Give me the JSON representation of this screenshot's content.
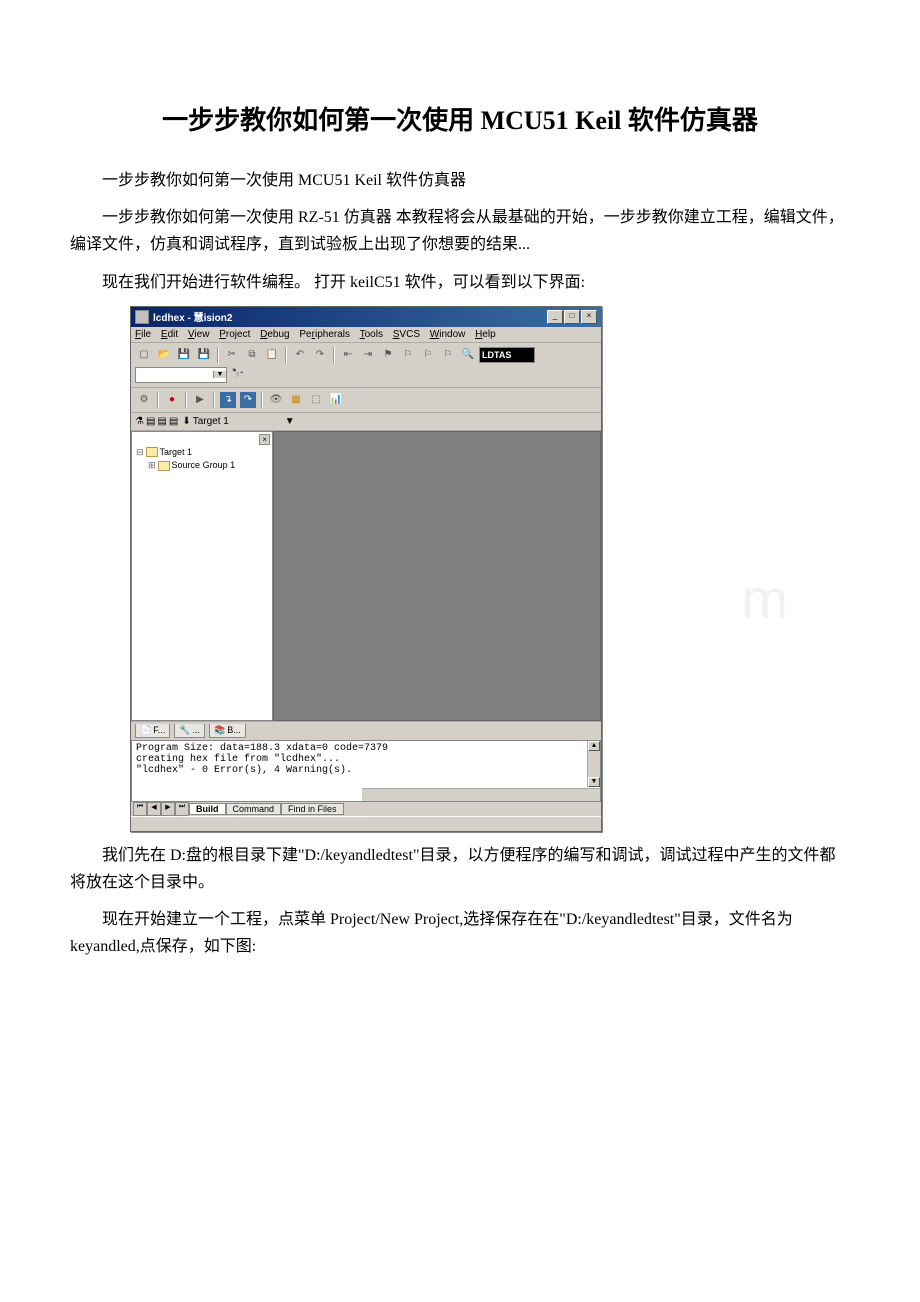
{
  "doc": {
    "title": "一步步教你如何第一次使用 MCU51 Keil 软件仿真器",
    "p1": "一步步教你如何第一次使用 MCU51 Keil 软件仿真器",
    "p2": "一步步教你如何第一次使用 RZ-51 仿真器 本教程将会从最基础的开始，一步步教你建立工程，编辑文件，编译文件，仿真和调试程序，直到试验板上出现了你想要的结果...",
    "p3": "现在我们开始进行软件编程。 打开 keilC51 软件，可以看到以下界面:",
    "p4": "我们先在 D:盘的根目录下建\"D:/keyandledtest\"目录，以方便程序的编写和调试，调试过程中产生的文件都将放在这个目录中。",
    "p5": "现在开始建立一个工程，点菜单 Project/New Project,选择保存在在\"D:/keyandledtest\"目录，文件名为 keyandled,点保存，如下图:"
  },
  "keil": {
    "title": "lcdhex - 慧ision2",
    "menus": [
      "File",
      "Edit",
      "View",
      "Project",
      "Debug",
      "Peripherals",
      "Tools",
      "SVCS",
      "Window",
      "Help"
    ],
    "target_combo": "Target 1",
    "tree": {
      "l1": "Target 1",
      "l2": "Source Group 1"
    },
    "bottom_tabs": {
      "t1": "F...",
      "t2": "...",
      "t3": "B..."
    },
    "output": {
      "line1": "Program Size: data=188.3 xdata=0 code=7379",
      "line2": "creating hex file from \"lcdhex\"...",
      "line3": "\"lcdhex\" - 0 Error(s), 4 Warning(s)."
    },
    "output_tabs": [
      "Build",
      "Command",
      "Find in Files"
    ]
  },
  "icons": {
    "new": "▢",
    "open": "📂",
    "save": "💾",
    "cut": "✂",
    "copy": "⧉",
    "paste": "📋",
    "undo": "↶",
    "redo": "↷",
    "indent": "≡",
    "outdent": "≡",
    "bookmark": "⚑",
    "find": "🔍",
    "print": "⎙",
    "binoculars": "🔭"
  },
  "watermark": "m"
}
